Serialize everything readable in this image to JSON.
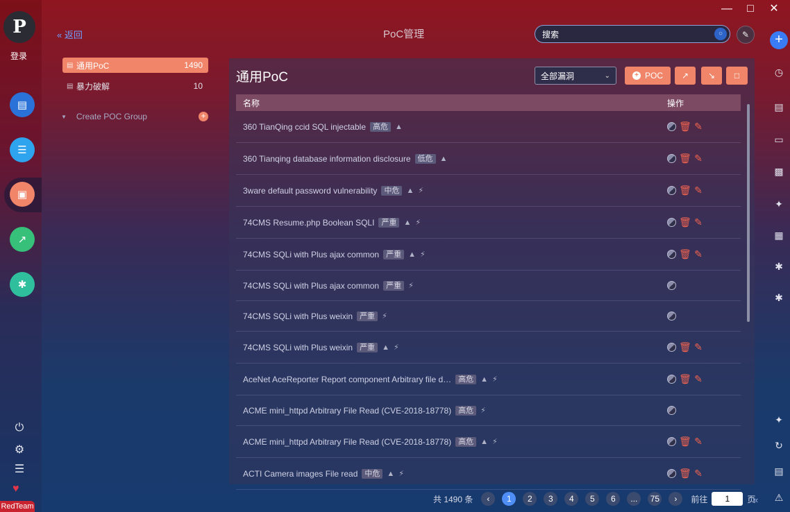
{
  "sidebar": {
    "login": "登录",
    "logo_glyph": "P",
    "apps": [
      {
        "icon": "browser-icon",
        "color": "#2a72d8"
      },
      {
        "icon": "list-icon",
        "color": "#2ea4ef"
      },
      {
        "icon": "poc-icon",
        "color": "#f0856a"
      },
      {
        "icon": "chart-icon",
        "color": "#36c07a"
      },
      {
        "icon": "plugin-icon",
        "color": "#2fbf9d"
      }
    ],
    "badge": "RedTeam"
  },
  "header": {
    "back_label": "返回",
    "title": "PoC管理",
    "search_placeholder": "搜索"
  },
  "groups": [
    {
      "name": "通用PoC",
      "count": "1490",
      "active": true
    },
    {
      "name": "暴力破解",
      "count": "10",
      "active": false
    }
  ],
  "create_group_label": "Create POC Group",
  "panel": {
    "title": "通用PoC",
    "filter_value": "全部漏洞",
    "poc_button": "POC"
  },
  "table": {
    "headers": [
      "名称",
      "操作"
    ],
    "rows": [
      {
        "name": "360 TianQing ccid SQL injectable",
        "level": "高危",
        "bolt": false,
        "ops": true
      },
      {
        "name": "360 Tianqing database information disclosure",
        "level": "低危",
        "bolt": false,
        "ops": true
      },
      {
        "name": "3ware default password vulnerability",
        "level": "中危",
        "bolt": true,
        "ops": true
      },
      {
        "name": "74CMS Resume.php Boolean SQLI",
        "level": "严重",
        "bolt": true,
        "ops": true
      },
      {
        "name": "74CMS SQLi with Plus ajax common",
        "level": "严重",
        "bolt": true,
        "ops": true
      },
      {
        "name": "74CMS SQLi with Plus ajax common",
        "level": "严重",
        "bolt": true,
        "ops": false,
        "noperson": true
      },
      {
        "name": "74CMS SQLi with Plus weixin",
        "level": "严重",
        "bolt": true,
        "ops": false,
        "noperson": true
      },
      {
        "name": "74CMS SQLi with Plus weixin",
        "level": "严重",
        "bolt": true,
        "ops": true
      },
      {
        "name": "AceNet AceReporter Report component Arbitrary file d…",
        "level": "高危",
        "bolt": true,
        "ops": true
      },
      {
        "name": "ACME mini_httpd Arbitrary File Read (CVE-2018-18778)",
        "level": "高危",
        "bolt": true,
        "ops": false,
        "noperson": true
      },
      {
        "name": "ACME mini_httpd Arbitrary File Read (CVE-2018-18778)",
        "level": "高危",
        "bolt": true,
        "ops": true
      },
      {
        "name": "ACTI Camera images File read",
        "level": "中危",
        "bolt": true,
        "ops": true
      }
    ]
  },
  "pagination": {
    "total": "共 1490 条",
    "pages": [
      "1",
      "2",
      "3",
      "4",
      "5",
      "6",
      "...",
      "75"
    ],
    "current": "1",
    "goto_label": "前往",
    "goto_value": "1",
    "page_suffix": "页"
  }
}
